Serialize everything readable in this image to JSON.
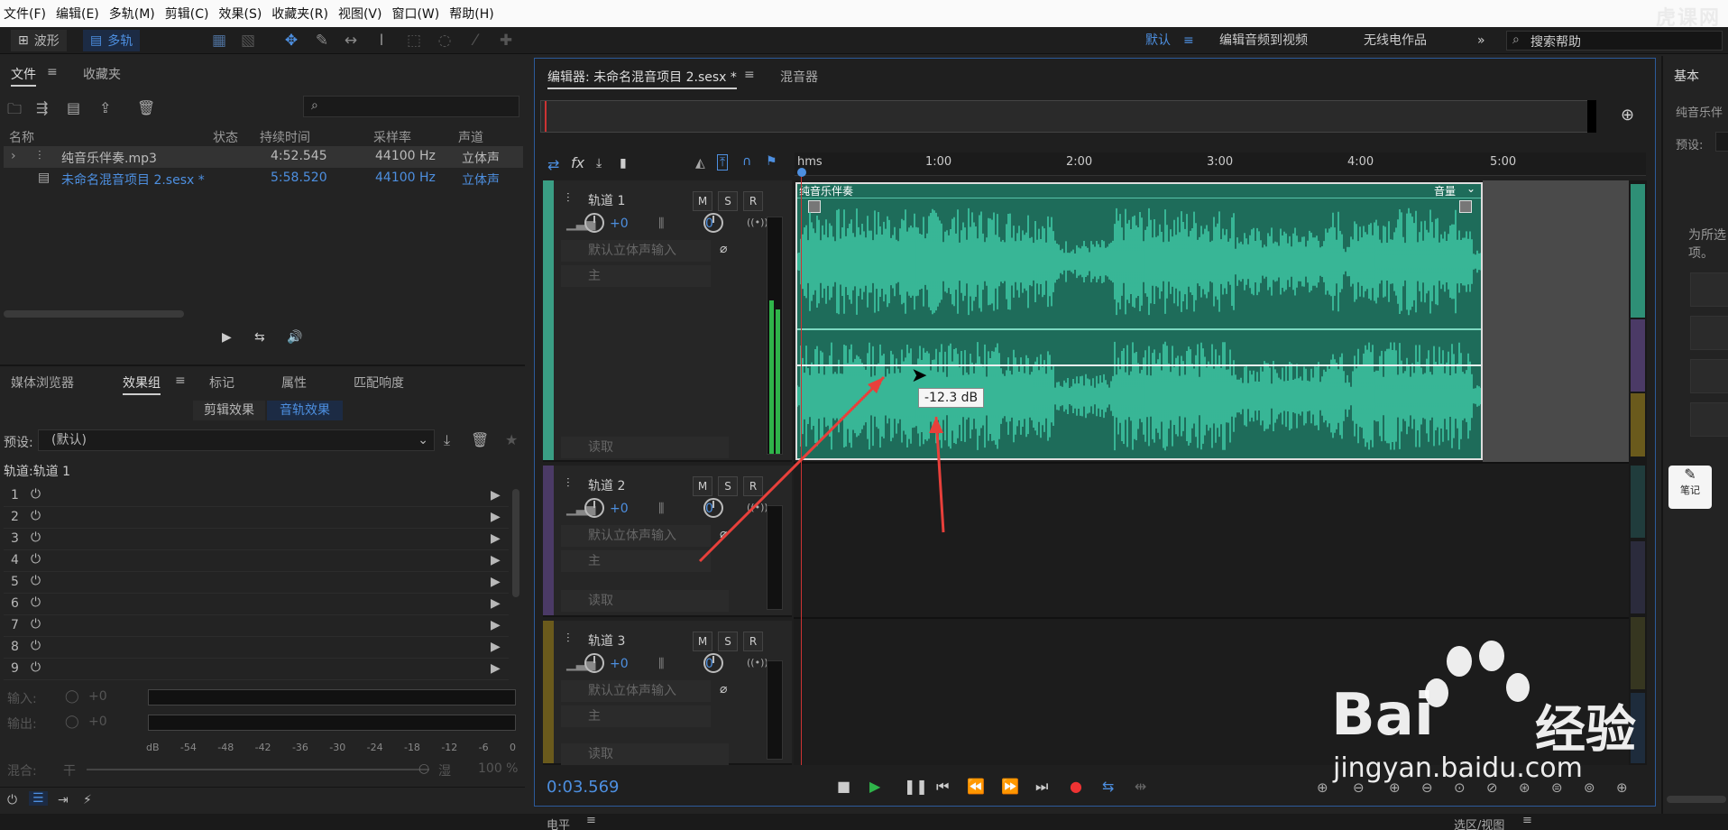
{
  "menu": [
    "文件(F)",
    "编辑(E)",
    "多轨(M)",
    "剪辑(C)",
    "效果(S)",
    "收藏夹(R)",
    "视图(V)",
    "窗口(W)",
    "帮助(H)"
  ],
  "watermark_top": "虎课网",
  "toolbar": {
    "waveform": "波形",
    "multitrack": "多轨"
  },
  "workspaces": {
    "default": "默认",
    "edit_video": "编辑音频到视频",
    "radio": "无线电作品",
    "search_placeholder": "搜索帮助"
  },
  "files_panel": {
    "tab_files": "文件",
    "tab_favorites": "收藏夹",
    "headers": {
      "name": "名称",
      "status": "状态",
      "duration": "持续时间",
      "rate": "采样率",
      "channels": "声道"
    },
    "rows": [
      {
        "name": "纯音乐伴奏.mp3",
        "duration": "4:52.545",
        "rate": "44100 Hz",
        "channels": "立体声"
      },
      {
        "name": "未命名混音项目 2.sesx *",
        "duration": "5:58.520",
        "rate": "44100 Hz",
        "channels": "立体声"
      }
    ]
  },
  "effects_panel": {
    "tabs": [
      "媒体浏览器",
      "效果组",
      "标记",
      "属性",
      "匹配响度"
    ],
    "sub_clip": "剪辑效果",
    "sub_track": "音轨效果",
    "preset_label": "预设:",
    "preset_value": "(默认)",
    "track_label": "轨道:轨道 1",
    "slots": [
      "1",
      "2",
      "3",
      "4",
      "5",
      "6",
      "7",
      "8",
      "9"
    ],
    "input": "输入:",
    "output": "输出:",
    "gain_in": "+0",
    "gain_out": "+0",
    "db_ticks": [
      "dB",
      "-54",
      "-48",
      "-42",
      "-36",
      "-30",
      "-24",
      "-18",
      "-12",
      "-6",
      "0"
    ],
    "mix": "混合:",
    "dry": "干",
    "wet": "湿",
    "mix_pct": "100 %"
  },
  "editor": {
    "tab_editor": "编辑器: 未命名混音项目 2.sesx *",
    "tab_mixer": "混音器",
    "ruler": [
      "hms",
      "1:00",
      "2:00",
      "3:00",
      "4:00",
      "5:00"
    ],
    "clip_name": "纯音乐伴奏",
    "clip_vol": "音量",
    "tooltip": "-12.3 dB",
    "time": "0:03.569",
    "tracks": [
      {
        "name": "轨道 1",
        "vol": "+0",
        "pan": "0",
        "input": "默认立体声输入",
        "output": "主",
        "mode": "读取"
      },
      {
        "name": "轨道 2",
        "vol": "+0",
        "pan": "0",
        "input": "默认立体声输入",
        "output": "主",
        "mode": "读取"
      },
      {
        "name": "轨道 3",
        "vol": "+0",
        "pan": "0",
        "input": "默认立体声输入",
        "output": "主",
        "mode": "读取"
      }
    ]
  },
  "right_panel": {
    "title": "基本",
    "clip": "纯音乐伴",
    "preset": "预设:",
    "hint1": "为所选",
    "hint2": "项。",
    "notes": "笔记"
  },
  "bottom": {
    "levels": "电平",
    "selection": "选区/视图"
  },
  "watermark": {
    "brand": "Bai",
    "brand2": "经验",
    "url": "jingyan.baidu.com"
  },
  "colors": {
    "track1": "#3a9e84",
    "track2": "#4b3a66",
    "track3": "#6a5a1c",
    "wave": "#3ec9a5",
    "accent": "#4d8fe0",
    "arrow": "#e8403b"
  }
}
